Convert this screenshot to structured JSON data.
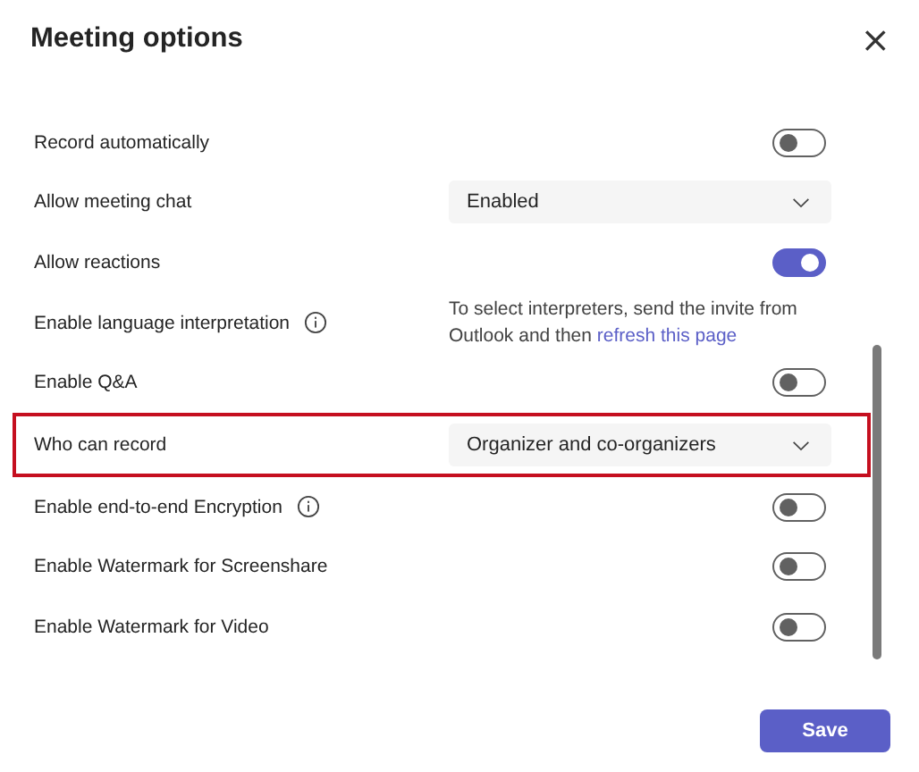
{
  "dialog": {
    "title": "Meeting options",
    "close": "×"
  },
  "options": [
    {
      "kind": "toggle",
      "label": "Record automatically",
      "on": false
    },
    {
      "kind": "dropdown",
      "label": "Allow meeting chat",
      "value": "Enabled"
    },
    {
      "kind": "toggle",
      "label": "Allow reactions",
      "on": true
    },
    {
      "kind": "note",
      "label": "Enable language interpretation",
      "info": true,
      "text": "To select interpreters, send the invite from Outlook and then",
      "link": "refresh this page"
    },
    {
      "kind": "toggle",
      "label": "Enable Q&A",
      "on": false
    },
    {
      "kind": "dropdown",
      "label": "Who can record",
      "value": "Organizer and co-organizers",
      "highlighted": true
    },
    {
      "kind": "toggle",
      "label": "Enable end-to-end Encryption",
      "info": true,
      "on": false
    },
    {
      "kind": "toggle",
      "label": "Enable Watermark for Screenshare",
      "on": false
    },
    {
      "kind": "toggle",
      "label": "Enable Watermark for Video",
      "on": false
    }
  ],
  "save": "Save"
}
